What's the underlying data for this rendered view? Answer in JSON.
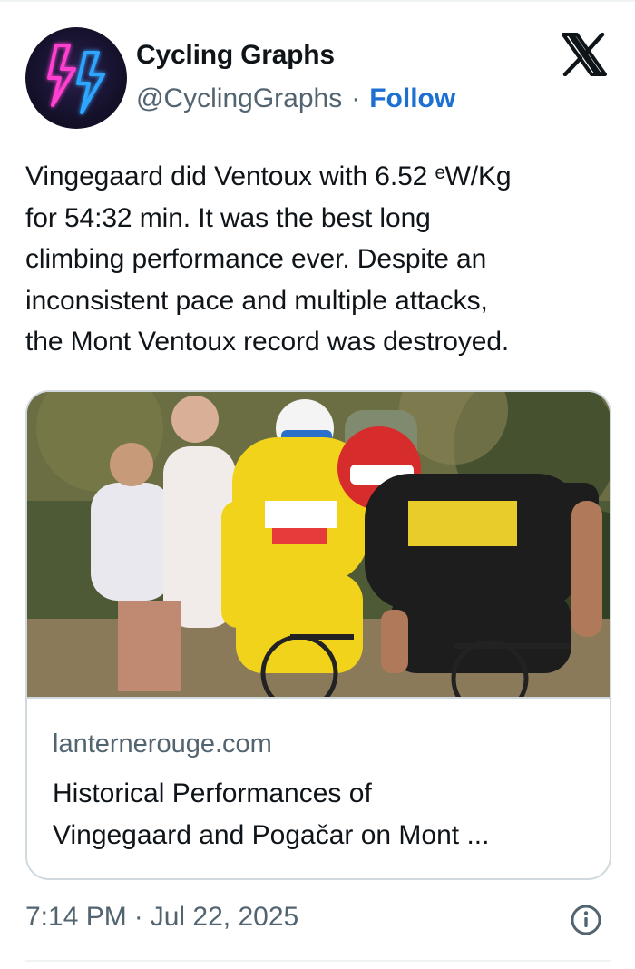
{
  "author": {
    "display_name": "Cycling Graphs",
    "handle": "@CyclingGraphs",
    "separator": "·",
    "follow_label": "Follow",
    "avatar_icon": "neon-lightning-bolts-icon"
  },
  "brand": {
    "logo_icon": "x-logo-icon"
  },
  "tweet": {
    "lines": [
      "Vingegaard did Ventoux with 6.52 ᵉW/Kg",
      "for 54:32 min. It was the best long",
      "climbing performance ever. Despite an",
      "inconsistent pace and multiple attacks,",
      "the Mont Ventoux record was destroyed."
    ]
  },
  "card": {
    "domain": "lanternerouge.com",
    "title_lines": [
      "Historical Performances of",
      "Vingegaard and Pogačar on Mont ..."
    ],
    "image_icon": "cyclists-photo"
  },
  "footer": {
    "time": "7:14 PM",
    "separator": "·",
    "date": "Jul 22, 2025",
    "info_icon": "info-icon"
  },
  "colors": {
    "link_blue": "#1d6fd1",
    "text_primary": "#0f1419",
    "text_secondary": "#536471",
    "border": "#cfd9de",
    "jersey_yellow": "#f2d31b",
    "neon_pink": "#ff3fd0",
    "neon_blue": "#2fa6ff"
  }
}
